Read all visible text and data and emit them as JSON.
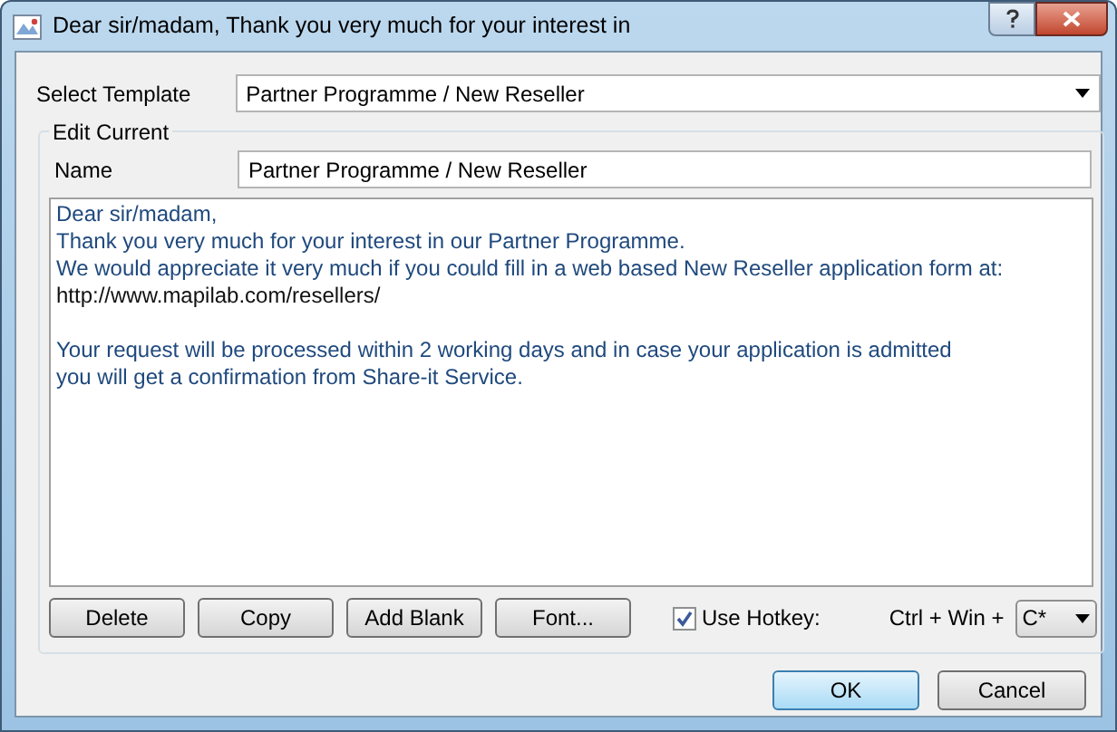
{
  "window": {
    "title": "Dear sir/madam, Thank you very much for your interest in"
  },
  "select_template": {
    "label": "Select Template",
    "value": "Partner Programme / New Reseller"
  },
  "edit_current": {
    "title": "Edit Current",
    "name_label": "Name",
    "name_value": "Partner Programme / New Reseller",
    "paragraphs": [
      {
        "lines": [
          {
            "text": "Dear sir/madam,",
            "kind": "text"
          },
          {
            "text": "Thank you very much for your interest in our Partner Programme.",
            "kind": "text"
          },
          {
            "text": "We would appreciate it very much if you could fill in a web based New Reseller application form at:",
            "kind": "text"
          },
          {
            "text": "http://www.mapilab.com/resellers/",
            "kind": "url"
          }
        ]
      },
      {
        "lines": [
          {
            "text": "Your request will be processed within 2 working days and in case your application is admitted",
            "kind": "text"
          },
          {
            "text": "you will get a confirmation from Share-it Service.",
            "kind": "text"
          }
        ]
      }
    ],
    "buttons": [
      "Delete",
      "Copy",
      "Add Blank",
      "Font..."
    ],
    "use_hotkey": {
      "label": "Use Hotkey:",
      "checked": true
    },
    "hotkey_prefix": "Ctrl + Win +",
    "hotkey_value": "C*"
  },
  "footer_buttons": [
    {
      "label": "OK",
      "default": true
    },
    {
      "label": "Cancel",
      "default": false
    }
  ]
}
